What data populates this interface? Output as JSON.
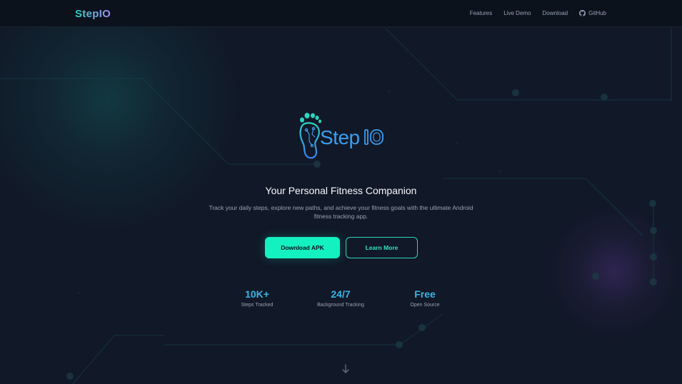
{
  "nav": {
    "brand": "StepIO",
    "links": [
      {
        "label": "Features"
      },
      {
        "label": "Live Demo"
      },
      {
        "label": "Download"
      },
      {
        "label": "GitHub",
        "icon": "github-icon"
      }
    ]
  },
  "hero": {
    "logo_text": "Step",
    "logo_suffix": "IO",
    "logo_icon": "footprint-icon",
    "headline": "Your Personal Fitness Companion",
    "subline": "Track your daily steps, explore new paths, and achieve your fitness goals with the ultimate Android fitness tracking app.",
    "primary_button": "Download APK",
    "secondary_button": "Learn More"
  },
  "stats": [
    {
      "value": "10K+",
      "label": "Steps Tracked"
    },
    {
      "value": "24/7",
      "label": "Background Tracking"
    },
    {
      "value": "Free",
      "label": "Open Source"
    }
  ],
  "scroll_icon": "arrow-down-icon",
  "colors": {
    "background": "#111827",
    "accent": "#14f1c0",
    "stat_value": "#38b6e6",
    "logo_blue": "#3b9ef0"
  }
}
